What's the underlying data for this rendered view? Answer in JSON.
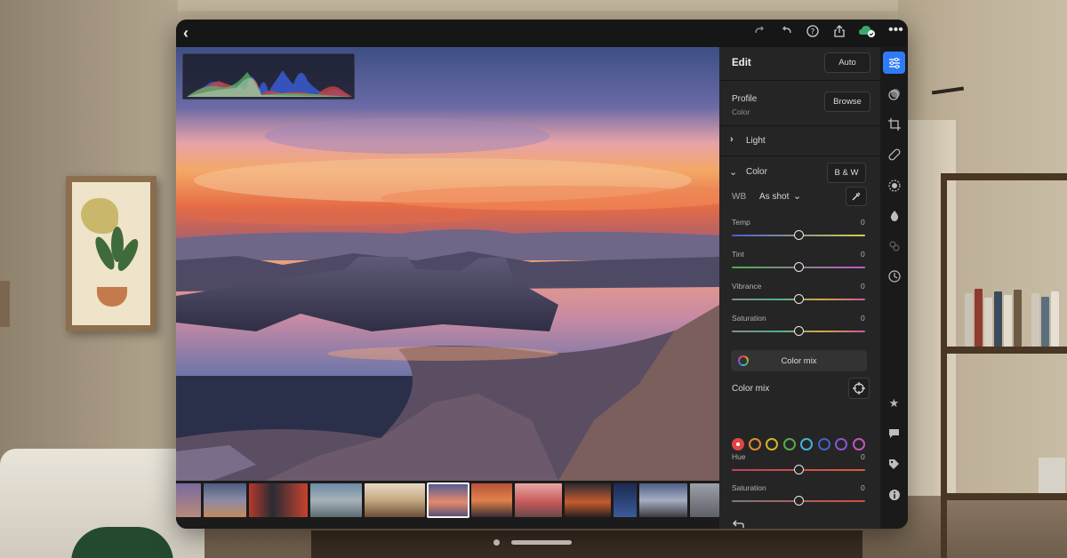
{
  "top_bar": {
    "back_icon": "chevron-left-icon",
    "icons": [
      "redo-icon",
      "undo-icon",
      "help-icon",
      "share-icon",
      "cloud-sync-icon",
      "more-icon"
    ]
  },
  "edit_panel": {
    "title": "Edit",
    "auto_label": "Auto",
    "profile": {
      "label": "Profile",
      "value": "Color",
      "browse_label": "Browse"
    },
    "light_label": "Light",
    "color": {
      "label": "Color",
      "bw_label": "B & W",
      "wb_label": "WB",
      "wb_value": "As shot",
      "sliders": [
        {
          "label": "Temp",
          "value": "0"
        },
        {
          "label": "Tint",
          "value": "0"
        },
        {
          "label": "Vibrance",
          "value": "0"
        },
        {
          "label": "Saturation",
          "value": "0"
        }
      ],
      "color_mix_button": "Color mix"
    },
    "color_mix": {
      "label": "Color mix",
      "swatches": [
        "#e04545",
        "#e08a30",
        "#d7b22a",
        "#5aa94b",
        "#3eb5d8",
        "#4661c8",
        "#8c55cc",
        "#c256b8"
      ],
      "sliders": [
        {
          "label": "Hue",
          "value": "0"
        },
        {
          "label": "Saturation",
          "value": "0"
        }
      ]
    }
  },
  "toolbar": {
    "tools": [
      "edit-sliders-icon",
      "presets-icon",
      "crop-icon",
      "healing-icon",
      "masking-icon",
      "optics-icon",
      "effects-icon",
      "versions-icon"
    ],
    "bottom_tools": [
      "star-icon",
      "comment-icon",
      "tag-icon",
      "info-icon"
    ]
  },
  "colors": {
    "accent": "#2f7bf5",
    "panel": "#252525",
    "window": "#1e1e1e"
  }
}
